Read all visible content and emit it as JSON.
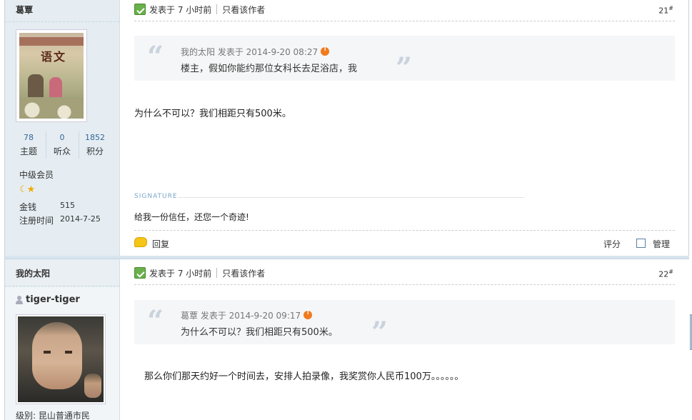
{
  "post1": {
    "author": "葛覃",
    "avatar_title": "语文",
    "stats": [
      {
        "value": "78",
        "label": "主题"
      },
      {
        "value": "0",
        "label": "听众"
      },
      {
        "value": "1852",
        "label": "积分"
      }
    ],
    "group": "中级会员",
    "money_label": "金钱",
    "money_value": "515",
    "reg_label": "注册时间",
    "reg_value": "2014-7-25",
    "posted": "发表于 7 小时前",
    "only_author": "只看该作者",
    "floor": "21",
    "floor_sup": "#",
    "quote": {
      "meta": "我的太阳 发表于 2014-9-20 08:27",
      "text": "楼主，假如你能约那位女科长去足浴店，我"
    },
    "content": "为什么不可以？我们相距只有500米。",
    "signature_label": "SIGNATURE",
    "signature": "给我一份信任，还您一个奇迹!",
    "reply": "回复",
    "rate": "评分",
    "manage": "管理"
  },
  "post2": {
    "author": "我的太阳",
    "username": "tiger-tiger",
    "posted": "发表于 7 小时前",
    "only_author": "只看该作者",
    "floor": "22",
    "floor_sup": "#",
    "quote": {
      "meta": "葛覃 发表于 2014-9-20 09:17",
      "text": "为什么不可以？我们相距只有500米。"
    },
    "content": "那么你们那天约好一个时间去，安排人拍录像，我奖赏你人民币100万。。。。。。",
    "level": "级别: 昆山普通市民"
  },
  "colors": {
    "sidebar_bg": "#e5edf2",
    "link_blue": "#336699",
    "quote_bg": "#f5f6f7"
  }
}
